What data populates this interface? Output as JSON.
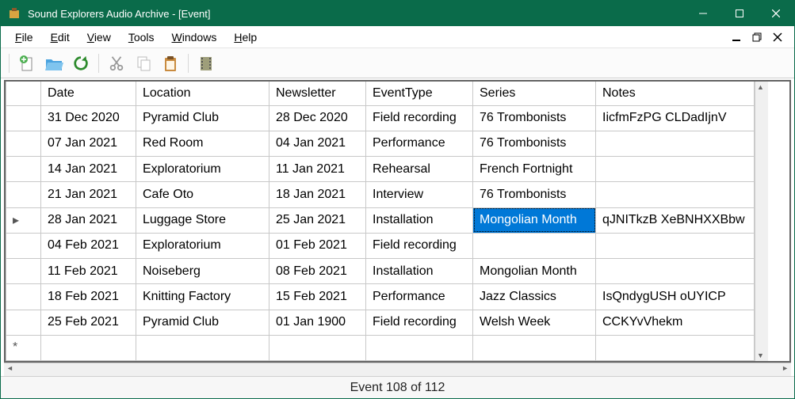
{
  "window": {
    "title": "Sound Explorers Audio Archive - [Event]"
  },
  "menu": {
    "file": "File",
    "edit": "Edit",
    "view": "View",
    "tools": "Tools",
    "windows": "Windows",
    "help": "Help"
  },
  "grid": {
    "columns": {
      "date": "Date",
      "location": "Location",
      "newsletter": "Newsletter",
      "eventtype": "EventType",
      "series": "Series",
      "notes": "Notes"
    },
    "rows": [
      {
        "date": "31 Dec 2020",
        "location": "Pyramid Club",
        "newsletter": "28 Dec 2020",
        "eventtype": "Field recording",
        "series": "76 Trombonists",
        "notes": "IicfmFzPG CLDadIjnV"
      },
      {
        "date": "07 Jan 2021",
        "location": "Red Room",
        "newsletter": "04 Jan 2021",
        "eventtype": "Performance",
        "series": "76 Trombonists",
        "notes": ""
      },
      {
        "date": "14 Jan 2021",
        "location": "Exploratorium",
        "newsletter": "11 Jan 2021",
        "eventtype": "Rehearsal",
        "series": "French Fortnight",
        "notes": ""
      },
      {
        "date": "21 Jan 2021",
        "location": "Cafe Oto",
        "newsletter": "18 Jan 2021",
        "eventtype": "Interview",
        "series": "76 Trombonists",
        "notes": ""
      },
      {
        "date": "28 Jan 2021",
        "location": "Luggage Store",
        "newsletter": "25 Jan 2021",
        "eventtype": "Installation",
        "series": "Mongolian Month",
        "notes": "qJNITkzB XeBNHXXBbw"
      },
      {
        "date": "04 Feb 2021",
        "location": "Exploratorium",
        "newsletter": "01 Feb 2021",
        "eventtype": "Field recording",
        "series": "",
        "notes": ""
      },
      {
        "date": "11 Feb 2021",
        "location": "Noiseberg",
        "newsletter": "08 Feb 2021",
        "eventtype": "Installation",
        "series": "Mongolian Month",
        "notes": ""
      },
      {
        "date": "18 Feb 2021",
        "location": "Knitting Factory",
        "newsletter": "15 Feb 2021",
        "eventtype": "Performance",
        "series": "Jazz Classics",
        "notes": "IsQndygUSH oUYICP"
      },
      {
        "date": "25 Feb 2021",
        "location": "Pyramid Club",
        "newsletter": "01 Jan 1900",
        "eventtype": "Field recording",
        "series": "Welsh Week",
        "notes": "CCKYvVhekm"
      }
    ],
    "currentRowMarker": "▸",
    "newRowMarker": "*",
    "selected": {
      "row": 4,
      "col": "series"
    }
  },
  "status": {
    "text": "Event 108 of 112"
  }
}
